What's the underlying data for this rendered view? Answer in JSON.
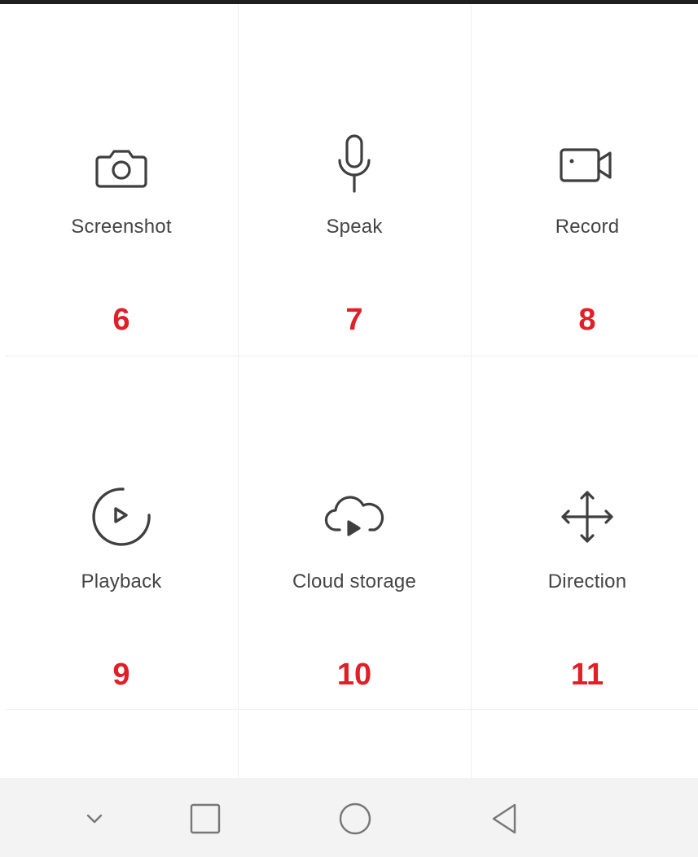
{
  "tiles": [
    {
      "label": "Screenshot",
      "number": "6",
      "icon": "camera-icon"
    },
    {
      "label": "Speak",
      "number": "7",
      "icon": "microphone-icon"
    },
    {
      "label": "Record",
      "number": "8",
      "icon": "video-camera-icon"
    },
    {
      "label": "Playback",
      "number": "9",
      "icon": "playback-icon"
    },
    {
      "label": "Cloud storage",
      "number": "10",
      "icon": "cloud-play-icon"
    },
    {
      "label": "Direction",
      "number": "11",
      "icon": "move-arrows-icon"
    }
  ],
  "colors": {
    "number_red": "#e01f26",
    "icon_gray": "#3f3f3f",
    "label_gray": "#444444",
    "nav_background": "#f3f3f3"
  },
  "nav_bar": {
    "buttons": [
      "chevron-down-icon",
      "square-icon",
      "circle-icon",
      "triangle-back-icon"
    ]
  }
}
